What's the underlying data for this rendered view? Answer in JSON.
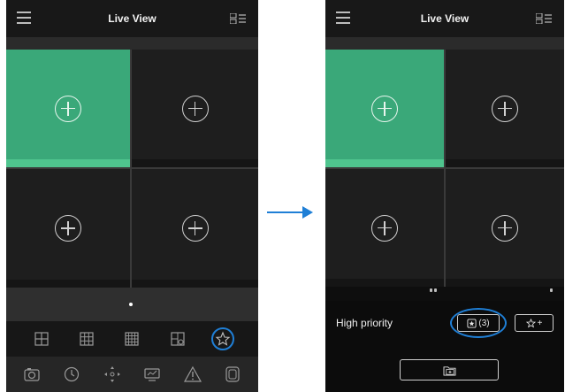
{
  "left_screen": {
    "header": {
      "title": "Live View",
      "menu_icon": "hamburger-menu-icon",
      "layout_icon": "layout-list-icon"
    },
    "tiles": [
      {
        "id": 1,
        "selected": true,
        "icon": "add-camera-icon"
      },
      {
        "id": 2,
        "selected": false,
        "icon": "add-camera-icon"
      },
      {
        "id": 3,
        "selected": false,
        "icon": "add-camera-icon"
      },
      {
        "id": 4,
        "selected": false,
        "icon": "add-camera-icon"
      }
    ],
    "pager": {
      "current_page": 1,
      "total_pages": 1
    },
    "layout_options": [
      "grid-4-icon",
      "grid-9-icon",
      "grid-16-icon",
      "custom-layout-icon",
      "favorites-star-icon"
    ],
    "highlighted_option": "favorites-star-icon",
    "toolbar": [
      "snapshot-icon",
      "playback-icon",
      "ptz-icon",
      "display-icon",
      "alarm-icon",
      "more-icon"
    ]
  },
  "right_screen": {
    "header": {
      "title": "Live View",
      "menu_icon": "hamburger-menu-icon",
      "layout_icon": "layout-list-icon"
    },
    "tiles": [
      {
        "id": 1,
        "selected": true,
        "icon": "add-camera-icon"
      },
      {
        "id": 2,
        "selected": false,
        "icon": "add-camera-icon"
      },
      {
        "id": 3,
        "selected": false,
        "icon": "add-camera-icon"
      },
      {
        "id": 4,
        "selected": false,
        "icon": "add-camera-icon"
      }
    ],
    "priority": {
      "label": "High priority",
      "favorite_count_text": "(3)",
      "add_favorite_text": "+",
      "folder_icon": "add-folder-icon"
    }
  },
  "colors": {
    "selected_tile": "#3aa879",
    "highlight_ring": "#1f7fd6",
    "arrow": "#1f7fd6",
    "background": "#0e0e0e"
  }
}
